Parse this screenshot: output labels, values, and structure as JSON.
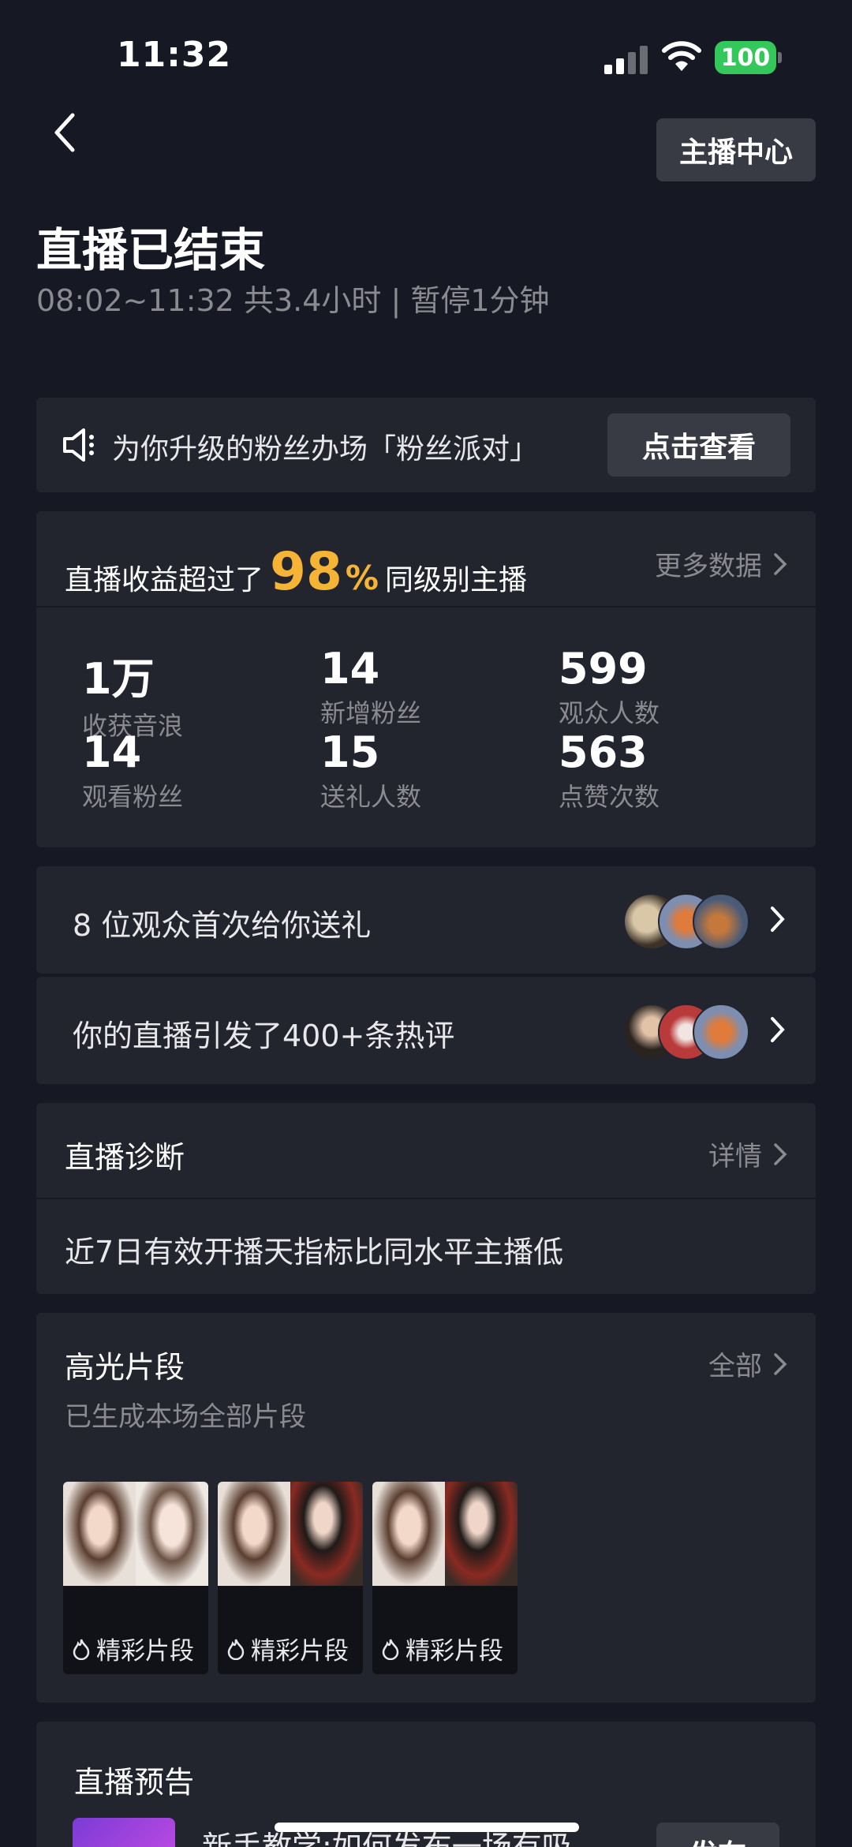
{
  "status_bar": {
    "time": "11:32",
    "battery": "100"
  },
  "header": {
    "anchor_center_label": "主播中心",
    "title": "直播已结束",
    "subtitle": "08:02~11:32 共3.4小时 | 暂停1分钟"
  },
  "promo": {
    "text": "为你升级的粉丝办场「粉丝派对」",
    "button": "点击查看"
  },
  "stats": {
    "revenue_prefix": "直播收益超过了",
    "revenue_percent": "98",
    "percent_sign": "%",
    "revenue_suffix": "同级别主播",
    "more": "更多数据",
    "items": [
      {
        "value": "1万",
        "label": "收获音浪"
      },
      {
        "value": "14",
        "label": "新增粉丝"
      },
      {
        "value": "599",
        "label": "观众人数"
      },
      {
        "value": "14",
        "label": "观看粉丝"
      },
      {
        "value": "15",
        "label": "送礼人数"
      },
      {
        "value": "563",
        "label": "点赞次数"
      }
    ]
  },
  "rows": [
    {
      "text": "8 位观众首次给你送礼"
    },
    {
      "text": "你的直播引发了400+条热评"
    }
  ],
  "diagnosis": {
    "title": "直播诊断",
    "more": "详情",
    "body": "近7日有效开播天指标比同水平主播低"
  },
  "highlights": {
    "title": "高光片段",
    "more": "全部",
    "subtitle": "已生成本场全部片段",
    "clips": [
      {
        "label": "精彩片段"
      },
      {
        "label": "精彩片段"
      },
      {
        "label": "精彩片段"
      }
    ]
  },
  "preview": {
    "title": "直播预告",
    "text": "新手教学:如何发布一场有吸",
    "button": "发布"
  },
  "colors": {
    "background": "#161823",
    "card": "#22242e",
    "accent": "#f6b436",
    "battery": "#34c759"
  }
}
